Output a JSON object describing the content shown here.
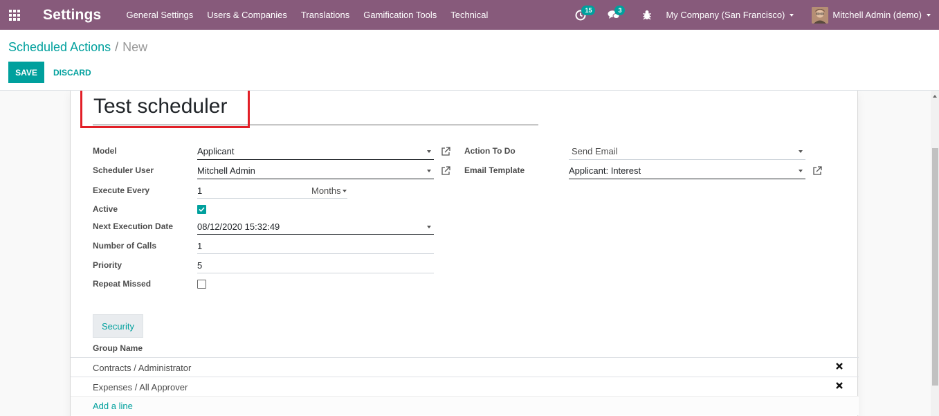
{
  "navbar": {
    "app_title": "Settings",
    "menu": [
      "General Settings",
      "Users & Companies",
      "Translations",
      "Gamification Tools",
      "Technical"
    ],
    "activity_count": "15",
    "messages_count": "3",
    "company": "My Company (San Francisco)",
    "user": "Mitchell Admin (demo)"
  },
  "breadcrumb": {
    "parent": "Scheduled Actions",
    "separator": "/",
    "current": "New"
  },
  "buttons": {
    "save": "SAVE",
    "discard": "DISCARD"
  },
  "form": {
    "name": "Test scheduler",
    "labels": {
      "model": "Model",
      "scheduler_user": "Scheduler User",
      "execute_every": "Execute Every",
      "active": "Active",
      "next_execution_date": "Next Execution Date",
      "number_of_calls": "Number of Calls",
      "priority": "Priority",
      "repeat_missed": "Repeat Missed",
      "action_to_do": "Action To Do",
      "email_template": "Email Template"
    },
    "values": {
      "model": "Applicant",
      "scheduler_user": "Mitchell Admin",
      "execute_every": "1",
      "interval_unit": "Months",
      "active": true,
      "next_execution_date": "08/12/2020 15:32:49",
      "number_of_calls": "1",
      "priority": "5",
      "repeat_missed": false,
      "action_to_do": "Send Email",
      "email_template": "Applicant: Interest"
    }
  },
  "security_tab": {
    "label": "Security",
    "column_header": "Group Name",
    "rows": [
      "Contracts / Administrator",
      "Expenses / All Approver"
    ],
    "add_line": "Add a line"
  },
  "colors": {
    "navbar": "#875a7b",
    "accent": "#00a09d",
    "highlight_box": "#e21f27"
  }
}
